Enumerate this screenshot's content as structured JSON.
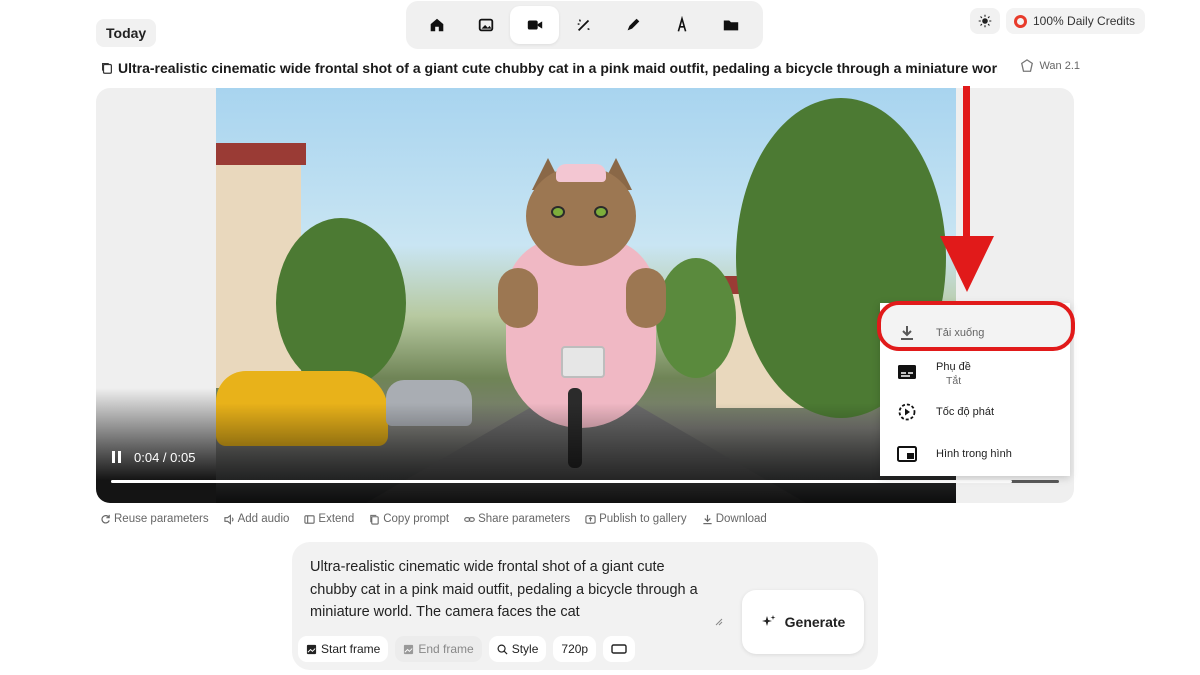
{
  "header": {
    "today_label": "Today",
    "tabs": [
      {
        "name": "home",
        "icon": "home-icon",
        "active": false
      },
      {
        "name": "image",
        "icon": "image-icon",
        "active": false
      },
      {
        "name": "video",
        "icon": "video-camera-icon",
        "active": true
      },
      {
        "name": "magic",
        "icon": "magic-wand-icon",
        "active": false
      },
      {
        "name": "edit",
        "icon": "pen-icon",
        "active": false
      },
      {
        "name": "text",
        "icon": "text-a-icon",
        "active": false
      },
      {
        "name": "folder",
        "icon": "folder-icon",
        "active": false
      }
    ],
    "credits_label": "100% Daily Credits",
    "credits_color": "#e83b2b"
  },
  "prompt_bar": {
    "title": "Ultra-realistic cinematic wide frontal shot of a giant cute chubby cat in a pink maid outfit, pedaling a bicycle through a miniature world. The ca...",
    "model": "Wan 2.1"
  },
  "video": {
    "time": "0:04 / 0:05",
    "progress": 0.95,
    "state": "playing"
  },
  "context_menu": {
    "items": [
      {
        "label": "Tải xuống",
        "icon": "download-icon"
      },
      {
        "label": "Phụ đề",
        "sub": "Tắt",
        "icon": "subtitles-icon"
      },
      {
        "label": "Tốc độ phát",
        "icon": "playback-speed-icon"
      },
      {
        "label": "Hình trong hình",
        "icon": "picture-in-picture-icon"
      }
    ],
    "highlight_color": "#e11a1a"
  },
  "actions": [
    {
      "label": "Reuse parameters",
      "icon": "reuse-icon"
    },
    {
      "label": "Add audio",
      "icon": "speaker-icon"
    },
    {
      "label": "Extend",
      "icon": "extend-icon"
    },
    {
      "label": "Copy prompt",
      "icon": "copy-icon"
    },
    {
      "label": "Share parameters",
      "icon": "link-icon"
    },
    {
      "label": "Publish to gallery",
      "icon": "publish-icon"
    },
    {
      "label": "Download",
      "icon": "download-icon"
    }
  ],
  "composer": {
    "text": "Ultra-realistic cinematic wide frontal shot of a giant cute chubby cat in a pink maid outfit, pedaling a bicycle through a miniature world. The camera faces the cat",
    "generate_label": "Generate",
    "chips": [
      {
        "label": "Start frame",
        "muted": false
      },
      {
        "label": "End frame",
        "muted": true
      },
      {
        "label": "Style",
        "muted": false
      },
      {
        "label": "720p",
        "muted": false
      },
      {
        "label": "",
        "icon": "aspect-ratio-icon",
        "muted": false
      }
    ]
  }
}
